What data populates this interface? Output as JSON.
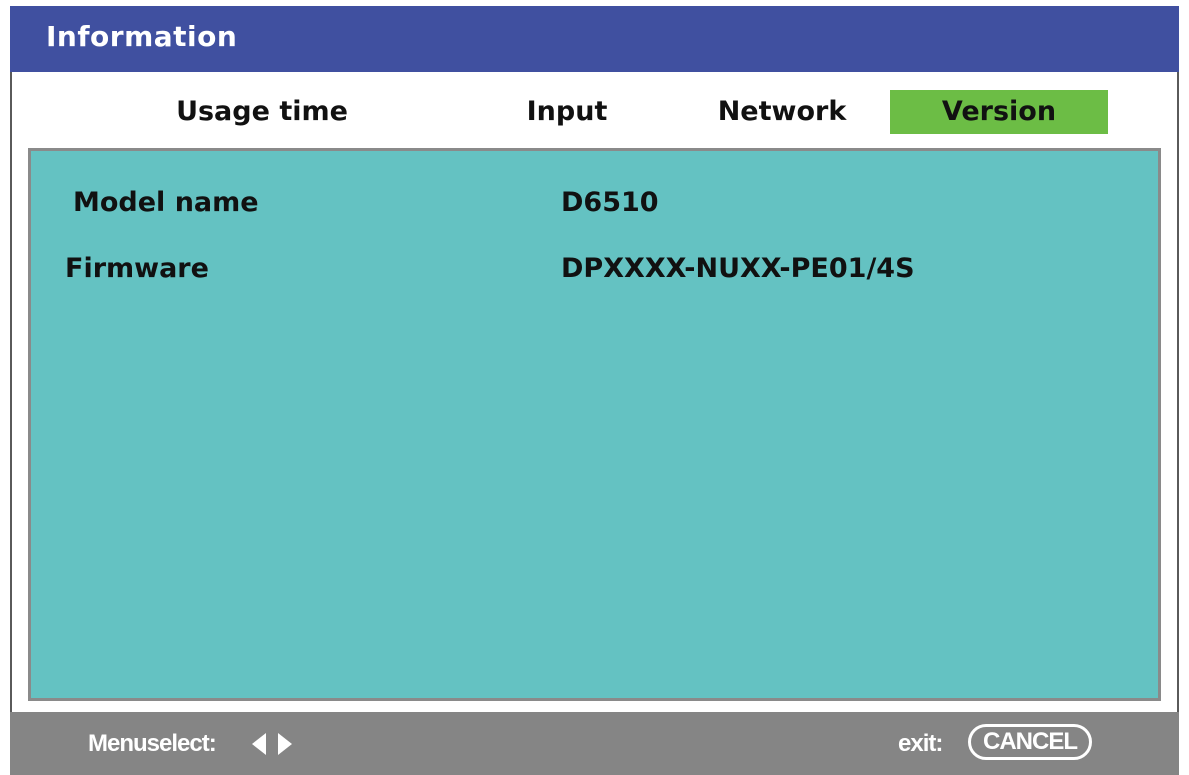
{
  "window": {
    "title": "Information"
  },
  "tabs": [
    {
      "label": "Usage time",
      "selected": false
    },
    {
      "label": "Input",
      "selected": false
    },
    {
      "label": "Network",
      "selected": false
    },
    {
      "label": "Version",
      "selected": true
    }
  ],
  "info": {
    "rows": [
      {
        "label": "Model name",
        "value": "D6510"
      },
      {
        "label": "Firmware",
        "value": "DPXXXX-NUXX-PE01/4S"
      }
    ]
  },
  "footer": {
    "menu_select_label": "Menuselect:",
    "menu_select_icon": "left-right-arrows-icon",
    "exit_label": "exit:",
    "cancel_label": "CANCEL"
  },
  "colors": {
    "title_bar": "#4050a0",
    "selected_tab": "#6cbd45",
    "content_background": "#64c2c2",
    "footer_background": "#858585"
  }
}
